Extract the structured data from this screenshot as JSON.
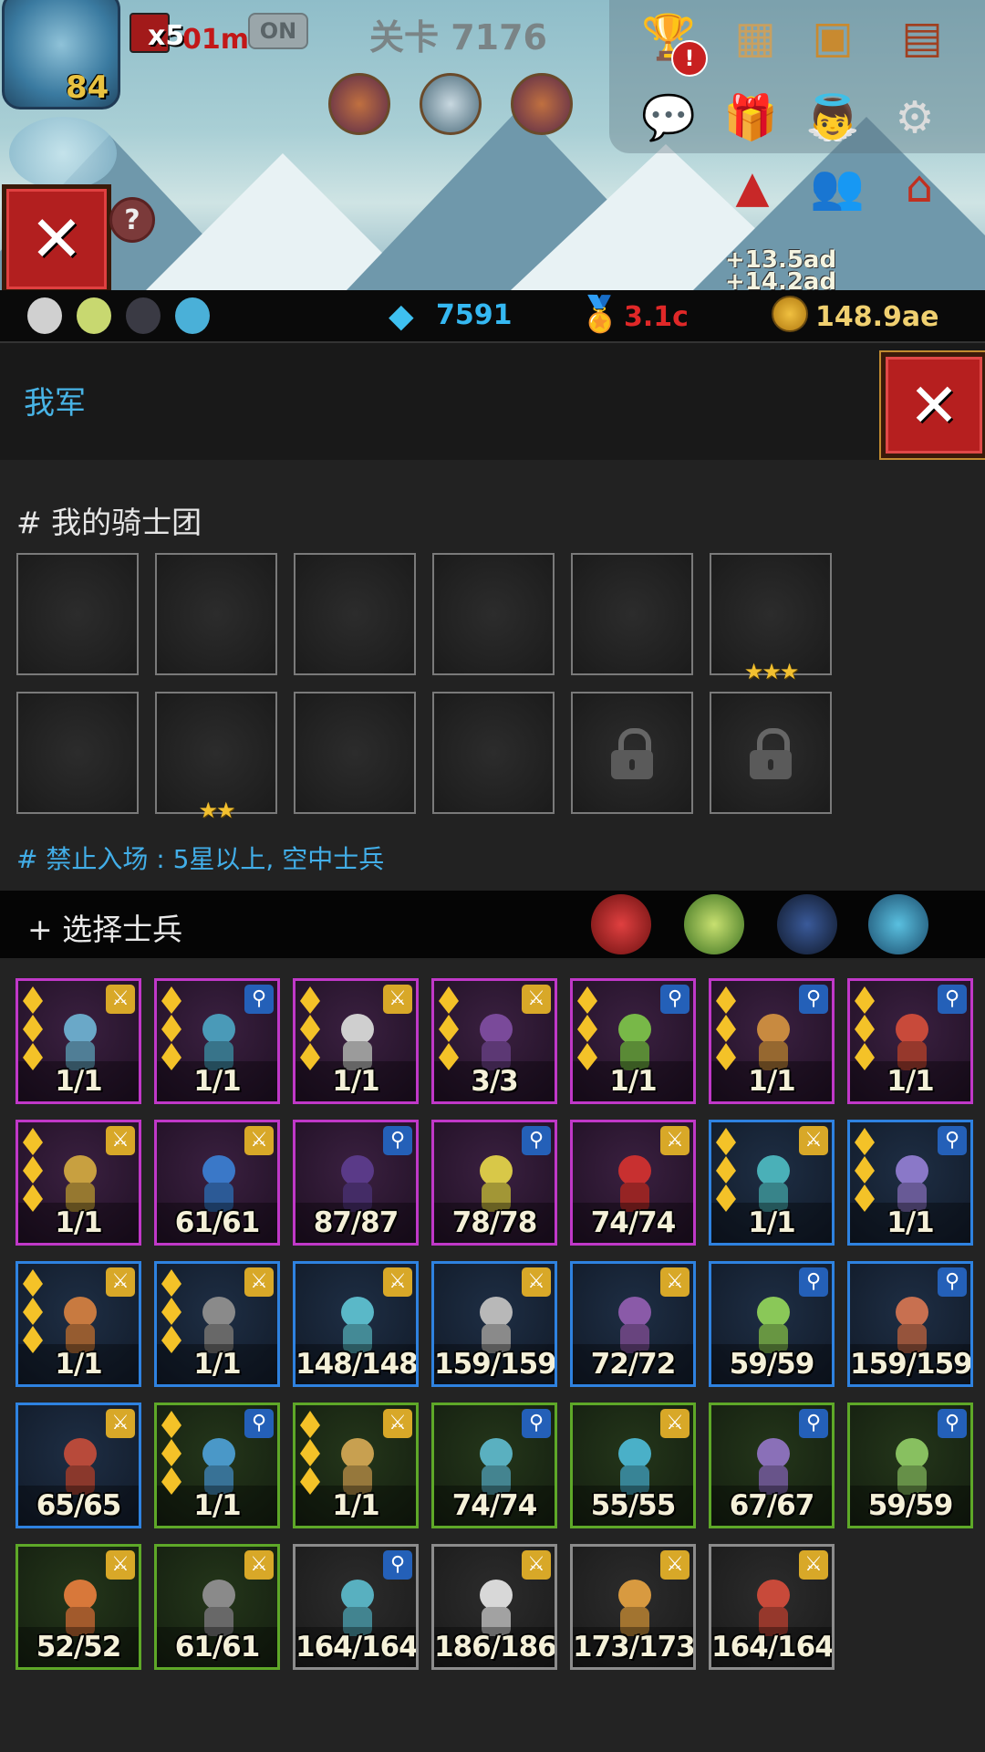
{
  "hud": {
    "hero_level": "84",
    "combo_multiplier": "x5",
    "combo_time": "01m",
    "toggle_label": "ON",
    "stage_title": "关卡 7176",
    "help_label": "?",
    "alert_label": "!",
    "float_text_1": "+13.5ad",
    "float_text_2": "+14.2ad"
  },
  "resources": {
    "gems": "7591",
    "medals": "3.1c",
    "gold": "148.9ae"
  },
  "panel": {
    "title": "我军",
    "close_label": "✕"
  },
  "knights": {
    "title": "# 我的骑士团",
    "restriction": "# 禁止入场 : 5星以上, 空中士兵",
    "slots": [
      {
        "stars": "",
        "locked": false
      },
      {
        "stars": "",
        "locked": false
      },
      {
        "stars": "",
        "locked": false
      },
      {
        "stars": "",
        "locked": false
      },
      {
        "stars": "",
        "locked": false
      },
      {
        "stars": "★★★",
        "locked": false
      },
      {
        "stars": "",
        "locked": false
      },
      {
        "stars": "★★",
        "locked": false
      },
      {
        "stars": "",
        "locked": false
      },
      {
        "stars": "",
        "locked": false
      },
      {
        "stars": "",
        "locked": true
      },
      {
        "stars": "",
        "locked": true
      }
    ]
  },
  "select": {
    "title": "+ 选择士兵",
    "filters": [
      "red-warrior-filter-icon",
      "green-elf-filter-icon",
      "dark-knight-filter-icon",
      "blue-beast-filter-icon"
    ]
  },
  "soldiers": [
    {
      "count": "1/1",
      "rarity": "purple",
      "tag": "sword",
      "pips": 3,
      "color": "#6aa8c8"
    },
    {
      "count": "1/1",
      "rarity": "purple",
      "tag": "search",
      "pips": 3,
      "color": "#4a9ab8"
    },
    {
      "count": "1/1",
      "rarity": "purple",
      "tag": "sword",
      "pips": 3,
      "color": "#cfcfcf"
    },
    {
      "count": "3/3",
      "rarity": "purple",
      "tag": "sword",
      "pips": 3,
      "color": "#7a4a9a"
    },
    {
      "count": "1/1",
      "rarity": "purple",
      "tag": "search",
      "pips": 3,
      "color": "#78b848"
    },
    {
      "count": "1/1",
      "rarity": "purple",
      "tag": "search",
      "pips": 3,
      "color": "#c88a40"
    },
    {
      "count": "1/1",
      "rarity": "purple",
      "tag": "search",
      "pips": 3,
      "color": "#c84a3a"
    },
    {
      "count": "1/1",
      "rarity": "purple",
      "tag": "sword",
      "pips": 3,
      "color": "#c8a040"
    },
    {
      "count": "61/61",
      "rarity": "purple",
      "tag": "sword",
      "pips": 0,
      "color": "#3a78c8"
    },
    {
      "count": "87/87",
      "rarity": "purple",
      "tag": "search",
      "pips": 0,
      "color": "#5a3a88"
    },
    {
      "count": "78/78",
      "rarity": "purple",
      "tag": "search",
      "pips": 0,
      "color": "#d8c848"
    },
    {
      "count": "74/74",
      "rarity": "purple",
      "tag": "sword",
      "pips": 0,
      "color": "#c83030"
    },
    {
      "count": "1/1",
      "rarity": "blue",
      "tag": "sword",
      "pips": 3,
      "color": "#4ab0b8"
    },
    {
      "count": "1/1",
      "rarity": "blue",
      "tag": "search",
      "pips": 3,
      "color": "#8a78c8"
    },
    {
      "count": "1/1",
      "rarity": "blue",
      "tag": "sword",
      "pips": 3,
      "color": "#c87a40"
    },
    {
      "count": "1/1",
      "rarity": "blue",
      "tag": "sword",
      "pips": 3,
      "color": "#8a8a8a"
    },
    {
      "count": "148/148",
      "rarity": "blue",
      "tag": "sword",
      "pips": 0,
      "color": "#5ab8c8"
    },
    {
      "count": "159/159",
      "rarity": "blue",
      "tag": "sword",
      "pips": 0,
      "color": "#b8b8b8"
    },
    {
      "count": "72/72",
      "rarity": "blue",
      "tag": "sword",
      "pips": 0,
      "color": "#8a5aa8"
    },
    {
      "count": "59/59",
      "rarity": "blue",
      "tag": "search",
      "pips": 0,
      "color": "#8ac858"
    },
    {
      "count": "159/159",
      "rarity": "blue",
      "tag": "search",
      "pips": 0,
      "color": "#c87050"
    },
    {
      "count": "65/65",
      "rarity": "blue",
      "tag": "sword",
      "pips": 0,
      "color": "#b84a3a"
    },
    {
      "count": "1/1",
      "rarity": "green",
      "tag": "search",
      "pips": 3,
      "color": "#4a98c8"
    },
    {
      "count": "1/1",
      "rarity": "green",
      "tag": "sword",
      "pips": 3,
      "color": "#c8a050"
    },
    {
      "count": "74/74",
      "rarity": "green",
      "tag": "search",
      "pips": 0,
      "color": "#5ab0c0"
    },
    {
      "count": "55/55",
      "rarity": "green",
      "tag": "sword",
      "pips": 0,
      "color": "#4ab0c8"
    },
    {
      "count": "67/67",
      "rarity": "green",
      "tag": "search",
      "pips": 0,
      "color": "#8a70b8"
    },
    {
      "count": "59/59",
      "rarity": "green",
      "tag": "search",
      "pips": 0,
      "color": "#88c060"
    },
    {
      "count": "52/52",
      "rarity": "green",
      "tag": "sword",
      "pips": 0,
      "color": "#d8783a"
    },
    {
      "count": "61/61",
      "rarity": "green",
      "tag": "sword",
      "pips": 0,
      "color": "#8a8a8a"
    },
    {
      "count": "164/164",
      "rarity": "grey",
      "tag": "search",
      "pips": 0,
      "color": "#58b0c0"
    },
    {
      "count": "186/186",
      "rarity": "grey",
      "tag": "sword",
      "pips": 0,
      "color": "#d8d8d8"
    },
    {
      "count": "173/173",
      "rarity": "grey",
      "tag": "sword",
      "pips": 0,
      "color": "#d89a40"
    },
    {
      "count": "164/164",
      "rarity": "grey",
      "tag": "sword",
      "pips": 0,
      "color": "#c84a3a"
    }
  ]
}
